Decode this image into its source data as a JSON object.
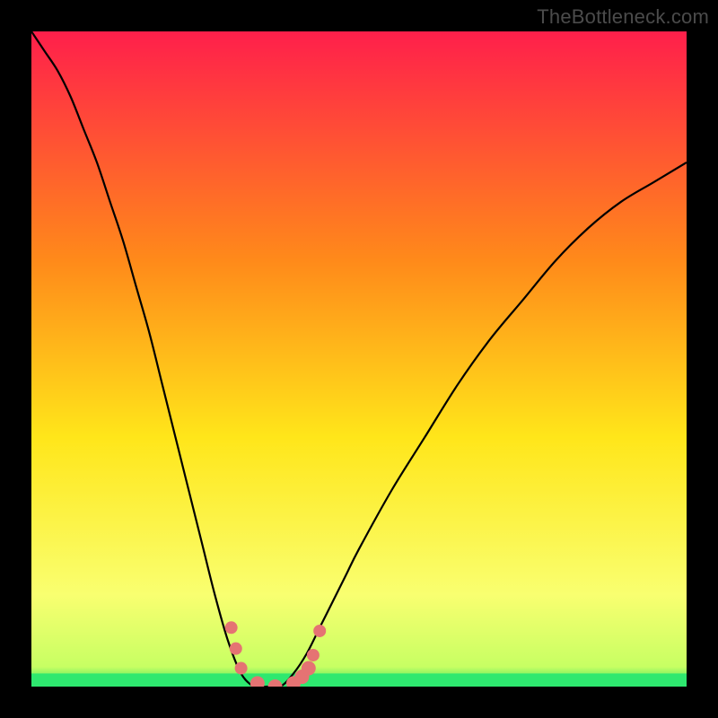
{
  "watermark": "TheBottleneck.com",
  "colors": {
    "page_bg": "#000000",
    "curve": "#000000",
    "markers": "#e57373",
    "green_band": "#2ee86f",
    "gradient_top": "#ff1f4b",
    "gradient_mid1": "#ff8a1a",
    "gradient_mid2": "#ffe61a",
    "gradient_mid3": "#f9ff70",
    "gradient_bottom": "#20e060"
  },
  "chart_data": {
    "type": "line",
    "title": "",
    "xlabel": "",
    "ylabel": "",
    "x_range_fraction": [
      0,
      1
    ],
    "y_range_percent": [
      0,
      100
    ],
    "series": [
      {
        "name": "bottleneck-curve",
        "x": [
          0.0,
          0.02,
          0.04,
          0.06,
          0.08,
          0.1,
          0.12,
          0.14,
          0.16,
          0.18,
          0.2,
          0.22,
          0.24,
          0.26,
          0.28,
          0.3,
          0.32,
          0.34,
          0.36,
          0.38,
          0.4,
          0.42,
          0.44,
          0.46,
          0.48,
          0.5,
          0.55,
          0.6,
          0.65,
          0.7,
          0.75,
          0.8,
          0.85,
          0.9,
          0.95,
          1.0
        ],
        "y": [
          100,
          97,
          94,
          90,
          85,
          80,
          74,
          68,
          61,
          54,
          46,
          38,
          30,
          22,
          14,
          7,
          2,
          0,
          0,
          0,
          2,
          5,
          9,
          13,
          17,
          21,
          30,
          38,
          46,
          53,
          59,
          65,
          70,
          74,
          77,
          80
        ]
      }
    ],
    "markers": [
      {
        "x": 0.305,
        "y": 9.0,
        "r": 7
      },
      {
        "x": 0.312,
        "y": 5.8,
        "r": 7
      },
      {
        "x": 0.32,
        "y": 2.8,
        "r": 7
      },
      {
        "x": 0.345,
        "y": 0.5,
        "r": 8
      },
      {
        "x": 0.372,
        "y": 0.0,
        "r": 8
      },
      {
        "x": 0.4,
        "y": 0.5,
        "r": 8
      },
      {
        "x": 0.413,
        "y": 1.5,
        "r": 8
      },
      {
        "x": 0.423,
        "y": 2.8,
        "r": 8
      },
      {
        "x": 0.43,
        "y": 4.8,
        "r": 7
      },
      {
        "x": 0.44,
        "y": 8.5,
        "r": 7
      }
    ],
    "green_band_percent": {
      "from": 0.0,
      "to": 2.0
    }
  }
}
